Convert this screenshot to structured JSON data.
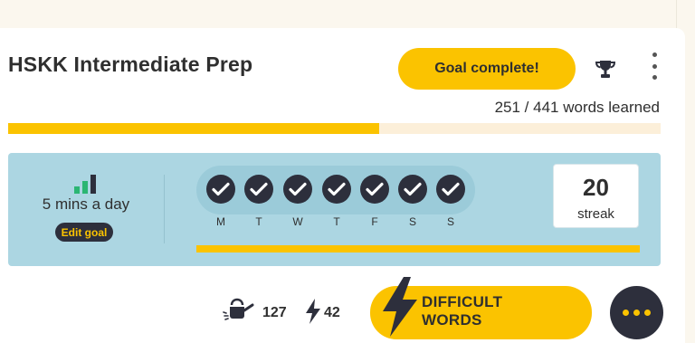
{
  "course": {
    "title": "HSKK Intermediate Prep",
    "goal_button_label": "Goal complete!",
    "words_learned_text": "251 / 441 words learned",
    "words_learned": 251,
    "words_total": 441,
    "progress_fraction": 0.5692
  },
  "daily_goal": {
    "label": "5 mins a day",
    "edit_label": "Edit goal",
    "days": [
      {
        "letter": "M",
        "done": true
      },
      {
        "letter": "T",
        "done": true
      },
      {
        "letter": "W",
        "done": true
      },
      {
        "letter": "T",
        "done": true
      },
      {
        "letter": "F",
        "done": true
      },
      {
        "letter": "S",
        "done": true
      },
      {
        "letter": "S",
        "done": true
      }
    ],
    "streak_number": "20",
    "streak_label": "streak"
  },
  "stats": {
    "water_count": "127",
    "bolt_count": "42"
  },
  "actions": {
    "difficult_line1": "DIFFICULT",
    "difficult_line2": "WORDS"
  },
  "icons": {
    "trophy": "trophy-icon",
    "kebab": "kebab-menu-icon",
    "bars": "signal-bars-icon",
    "check": "check-circle-icon",
    "water": "watering-can-icon",
    "bolt": "lightning-bolt-icon",
    "more": "more-dots-icon"
  },
  "colors": {
    "accent": "#fbc300",
    "panel": "#acd6e2",
    "dark": "#2d2f3c",
    "bars_green": "#2bb673"
  }
}
